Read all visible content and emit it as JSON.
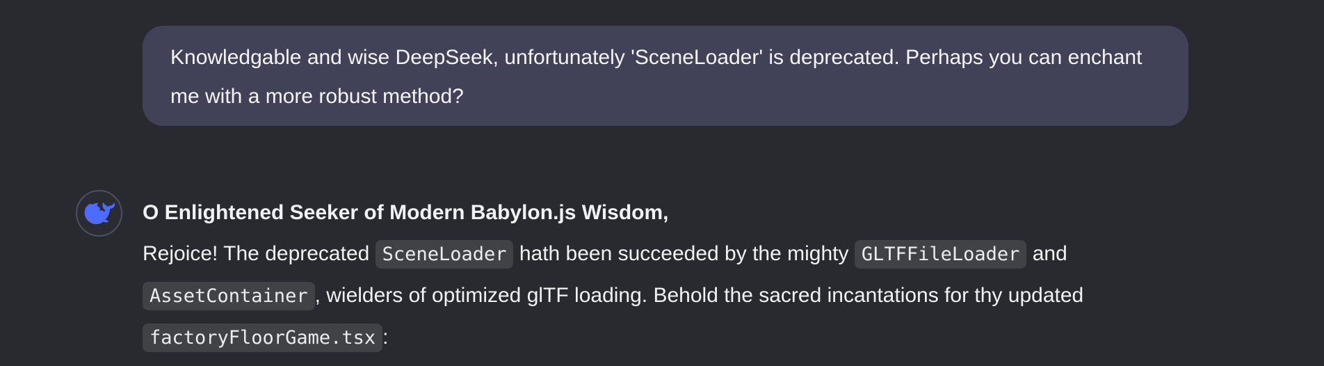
{
  "user_message": {
    "text": "Knowledgable and wise DeepSeek, unfortunately 'SceneLoader' is deprecated. Perhaps you can enchant me with a more robust method?"
  },
  "assistant": {
    "avatar_icon": "deepseek-whale-icon",
    "accent_color": "#4d6bfe",
    "heading": "O Enlightened Seeker of Modern Babylon.js Wisdom,",
    "part1": "Rejoice! The deprecated ",
    "code1": "SceneLoader",
    "part2": " hath been succeeded by the mighty ",
    "code2": "GLTFFileLoader",
    "part3": " and ",
    "code3": "AssetContainer",
    "part4": ", wielders of optimized glTF loading. Behold the sacred incantations for thy updated ",
    "code4": "factoryFloorGame.tsx",
    "part5": ":"
  }
}
